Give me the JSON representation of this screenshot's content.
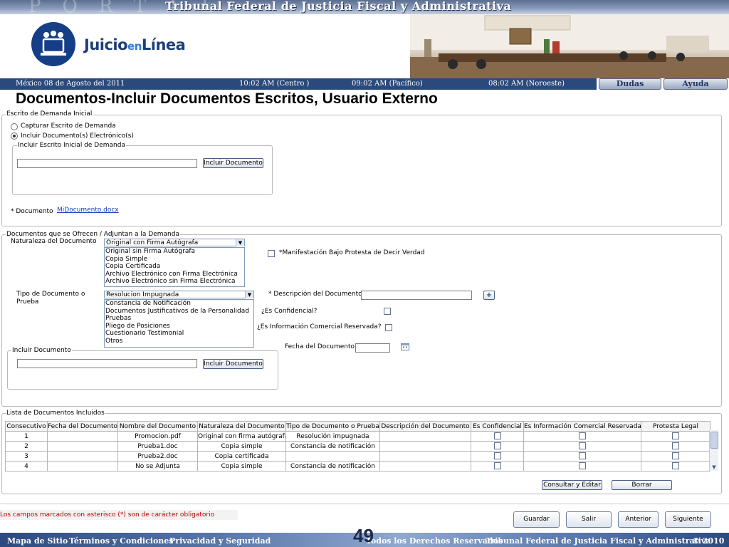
{
  "header": {
    "title": "Tribunal Federal de Justicia Fiscal y Administrativa",
    "ghost": "PORTAL",
    "logo_text_1": "Juicio",
    "logo_text_2": "en",
    "logo_text_3": "Línea",
    "date": "México 08 de Agosto del 2011",
    "time_centro": "10:02  AM (Centro )",
    "time_pacifico": "09:02 AM  (Pacífico)",
    "time_noroeste": "08:02 AM (Noroeste)",
    "btn_dudas": "Dudas",
    "btn_ayuda": "Ayuda"
  },
  "page_title": "Documentos-Incluir Documentos Escritos, Usuario Externo",
  "escrito": {
    "legend": "Escrito de Demanda Inicial",
    "radio_capturar": "Capturar Escrito de Demanda",
    "radio_incluir": "Incluir Documento(s) Electrónico(s)",
    "inner_legend": "Incluir Escrito Inicial de Demanda",
    "btn_incluir": "Incluir Documento",
    "doc_label": "* Documento",
    "doc_link": "MiDocumento.docx"
  },
  "ofrecen": {
    "legend": "Documentos que se Ofrecen / Adjuntan a la Demanda",
    "naturaleza_label": "Naturaleza del Documento",
    "naturaleza_selected": "Original con Firma Autógrafa",
    "naturaleza_options": [
      "Original sin Firma Autógrafa",
      "Copia Simple",
      "Copia Certificada",
      "Archivo Electrónico con Firma Electrónica",
      "Archivo Electrónico sin Firma Electrónica"
    ],
    "protesta_label": "*Manifestación Bajo Protesta de Decir Verdad",
    "tipo_label_1": "Tipo de Documento o",
    "tipo_label_2": "Prueba",
    "tipo_selected": "Resolucion Impugnada",
    "tipo_options": [
      "Constancia de Notificación",
      "Documentos Justificativos de la Personalidad",
      "Pruebas",
      "Pliego de Posiciones",
      "Cuestionario Testimonial",
      "Otros"
    ],
    "descripcion_label": "* Descripción del Documento",
    "add_btn": "+",
    "confidencial_label": "¿Es Confidencial?",
    "comercial_label": "¿Es Información Comercial Reservada?",
    "fecha_label": "Fecha del Documento",
    "incluir_legend": "Incluir Documento",
    "btn_incluir": "Incluir Documento"
  },
  "lista": {
    "legend": "Lista de Documentos Incluidos",
    "columns": [
      "Consecutivo",
      "Fecha del Documento",
      "Nombre del Documento",
      "Naturaleza del Documento",
      "Tipo de Documento o Prueba",
      "Descripción del Documento",
      "Es Confidencial",
      "Es Información Comercial Reservada",
      "Protesta Legal"
    ],
    "rows": [
      {
        "n": "1",
        "fecha": "",
        "nombre": "Promocion.pdf",
        "naturaleza": "Original con firma autógrafa",
        "tipo": "Resolución impugnada",
        "desc": ""
      },
      {
        "n": "2",
        "fecha": "",
        "nombre": "Prueba1.doc",
        "naturaleza": "Copia simple",
        "tipo": "Constancia de notificación",
        "desc": ""
      },
      {
        "n": "3",
        "fecha": "",
        "nombre": "Prueba2.doc",
        "naturaleza": "Copia certificada",
        "tipo": "",
        "desc": ""
      },
      {
        "n": "4",
        "fecha": "",
        "nombre": "No se Adjunta",
        "naturaleza": "Copia simple",
        "tipo": "Constancia de notificación",
        "desc": ""
      }
    ],
    "btn_consultar": "Consultar y Editar",
    "btn_borrar": "Borrar"
  },
  "note": "Los campos marcados con asterisco (*) son de carácter obligatorio",
  "nav": {
    "guardar": "Guardar",
    "salir": "Salir",
    "anterior": "Anterior",
    "siguiente": "Siguiente"
  },
  "footer": {
    "mapa": "Mapa de Sitio",
    "terminos": "Términos y Condiciones",
    "privacidad": "Privacidad y Seguridad",
    "page_number": "49",
    "derechos": "Todos los Derechos Reservados",
    "tribunal": "Tribunal Federal de Justicia Fiscal y Administrativa",
    "copyright": "© 2010"
  }
}
